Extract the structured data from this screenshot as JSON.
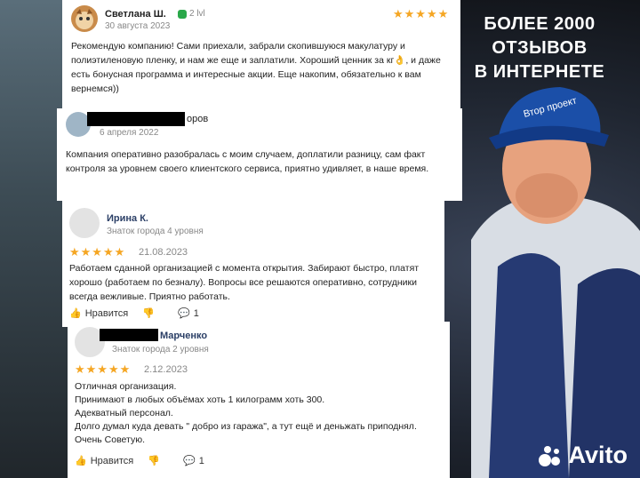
{
  "banner": {
    "headline_1": "БОЛЕЕ 2000",
    "headline_2": "ОТЗЫВОВ",
    "headline_3": "В ИНТЕРНЕТЕ"
  },
  "cap_brand": "Втор проект",
  "reviews": [
    {
      "name": "Светлана Ш.",
      "badge": "2 lvl",
      "date": "30 августа 2023",
      "stars": "★★★★★",
      "text": "Рекомендую компанию! Сами приехали, забрали скопившуюся макулатуру и полиэтиленовую пленку, и нам же еще и заплатили. Хороший ценник за кг👌, и даже есть бонусная программа и интересные акции. Еще накопим, обязательно к вам вернемся))"
    },
    {
      "name_suffix": "оров",
      "date": "6 апреля 2022",
      "text": "Компания оперативно разобралась с моим случаем, доплатили разницу, сам факт контроля за уровнем своего клиентского сервиса, приятно удивляет, в наше время."
    },
    {
      "name": "Ирина К.",
      "level": "Знаток города 4 уровня",
      "stars": "★★★★★",
      "date": "21.08.2023",
      "text": "Работаем сданной организацией с момента открытия. Забирают быстро, платят хорошо (работаем по безналу). Вопросы все решаются оперативно, сотрудники всегда вежливые. Приятно работать.",
      "like_label": "Нравится",
      "comments": "1"
    },
    {
      "name_suffix": "Марченко",
      "level": "Знаток города 2 уровня",
      "stars": "★★★★★",
      "date": "2.12.2023",
      "lines": [
        "Отличная организация.",
        "Принимают в любых объёмах хоть 1 килограмм хоть 300.",
        "Адекватный персонал.",
        "Долго думал куда девать \" добро из гаража\", а тут ещё и деньжать приподнял.",
        "Очень Советую."
      ],
      "like_label": "Нравится",
      "comments": "1"
    }
  ],
  "watermark": "Avito",
  "colors": {
    "star": "#f5a623",
    "cap": "#1b4fa8",
    "badge": "#2aa84a"
  }
}
